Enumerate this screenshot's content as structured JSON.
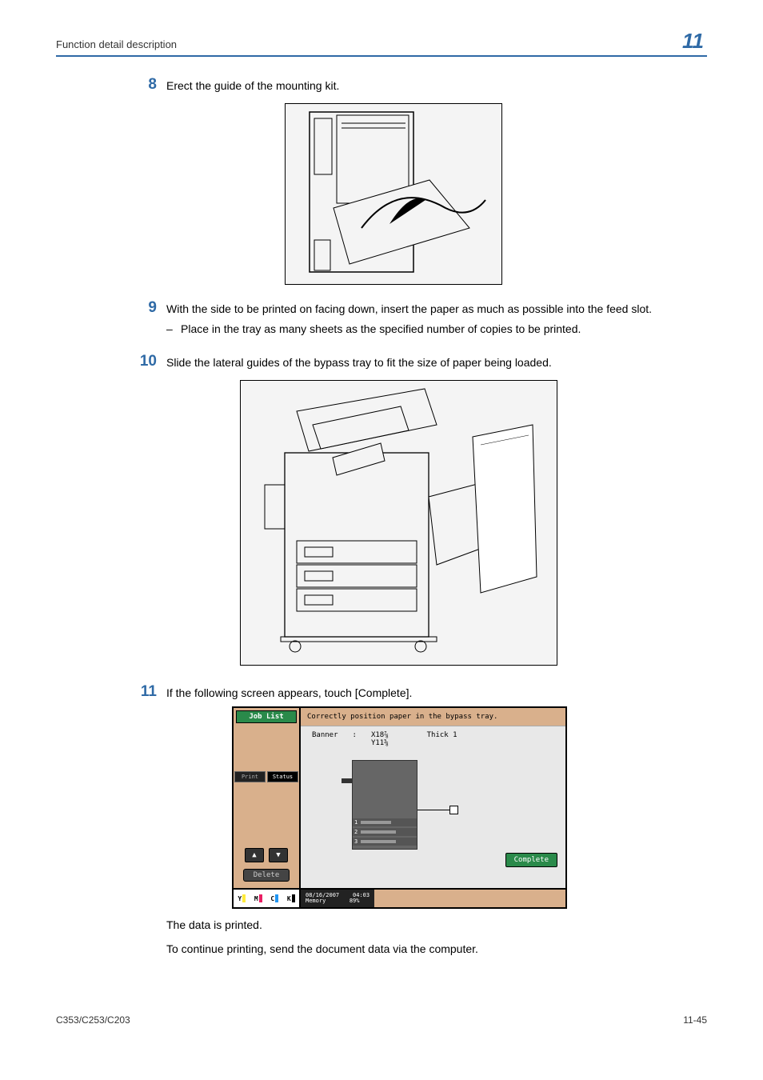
{
  "header": {
    "title": "Function detail description",
    "chapter": "11"
  },
  "steps": {
    "s8": {
      "num": "8",
      "text": "Erect the guide of the mounting kit."
    },
    "s9": {
      "num": "9",
      "text": "With the side to be printed on facing down, insert the paper as much as possible into the feed slot.",
      "sub": "Place in the tray as many sheets as the specified number of copies to be printed."
    },
    "s10": {
      "num": "10",
      "text": "Slide the lateral guides of the bypass tray to fit the size of paper being loaded."
    },
    "s11": {
      "num": "11",
      "text": "If the following screen appears, touch [Complete]."
    }
  },
  "screen": {
    "joblist": "Job List",
    "tab_left": "Print",
    "tab_right": "Status",
    "delete": "Delete",
    "msg": "Correctly position paper in the bypass tray.",
    "banner_label": "Banner",
    "colon": ":",
    "size": "X18⅞\nY11⅝",
    "thick": "Thick 1",
    "tray_nums": [
      "1",
      "2",
      "3"
    ],
    "complete": "Complete",
    "toner": {
      "y": "Y",
      "m": "M",
      "c": "C",
      "k": "K"
    },
    "datetime": {
      "date": "08/16/2007",
      "time": "04:03",
      "mem": "Memory",
      "pct": "89%"
    }
  },
  "paras": {
    "p1": "The data is printed.",
    "p2": "To continue printing, send the document data via the computer."
  },
  "footer": {
    "left": "C353/C253/C203",
    "right": "11-45"
  }
}
